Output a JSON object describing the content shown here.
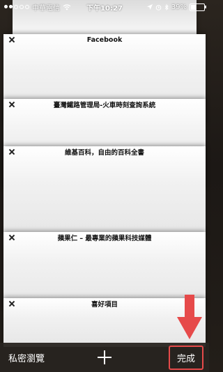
{
  "status": {
    "carrier": "中華電信",
    "time": "下午10:27",
    "battery": "39%",
    "battery_level": 0.39,
    "accent": "#ffffff"
  },
  "tabs": [
    {
      "title": "Facebook"
    },
    {
      "title": "臺灣鐵路管理局-火車時刻查詢系統"
    },
    {
      "title": "維基百科，自由的百科全書"
    },
    {
      "title": "蘋果仁 – 最專業的蘋果科技媒體"
    },
    {
      "title": "喜好項目"
    }
  ],
  "toolbar": {
    "private_label": "私密瀏覽",
    "done_label": "完成",
    "plus_icon": "plus-icon"
  },
  "annotation": {
    "color": "#e64a4a"
  }
}
